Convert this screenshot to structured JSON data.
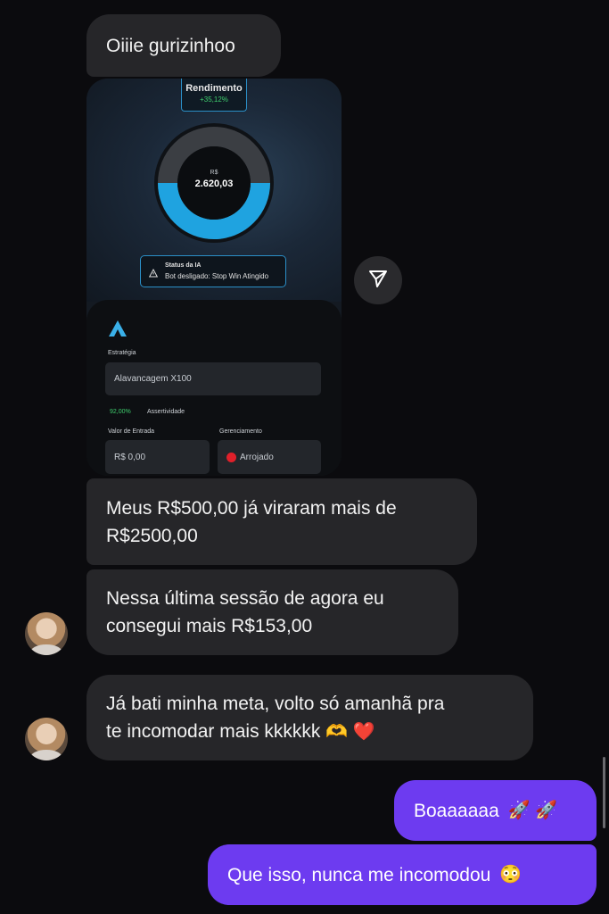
{
  "messages": {
    "greeting": "Oiiie gurizinhoo",
    "msg1_line1": "Meus R$500,00 já viraram mais de",
    "msg1_line2": "R$2500,00",
    "msg2_line1": "Nessa última sessão de agora eu",
    "msg2_line2": "consegui mais R$153,00",
    "msg3_line1": "Já bati minha meta, volto só amanhã pra",
    "msg3_line2": "te incomodar mais kkkkkk",
    "msg3_emojis": "🫶 ❤️",
    "reply1": "Boaaaaaa",
    "reply1_emojis": "🚀 🚀",
    "reply2": "Que isso, nunca me incomodou",
    "reply2_emoji": "😳"
  },
  "screenshot": {
    "rendimento_title": "Rendimento",
    "rendimento_value": "+35,12%",
    "balance_currency": "R$",
    "balance_value": "2.620,03",
    "donut_fill_fraction": 0.5,
    "status_title": "Status da IA",
    "status_text": "Bot desligado: Stop Win Atingido",
    "estrategia_label": "Estratégia",
    "estrategia_value": "Alavancagem X100",
    "assertividade_pct": "92,00%",
    "assertividade_label": "Assertividade",
    "entrada_label": "Valor de Entrada",
    "entrada_value": "R$ 0,00",
    "gerenciamento_label": "Gerenciamento",
    "gerenciamento_value": "Arrojado"
  },
  "icons": {
    "share": "send-icon",
    "warning": "warning-icon",
    "logo": "brand-logo-icon",
    "risk_dot": "red-dot-icon"
  },
  "colors": {
    "incoming_bubble": "#262629",
    "outgoing_bubble": "#6d3bf0",
    "donut_fill": "#1fa3e0",
    "positive": "#3fcf6e"
  }
}
